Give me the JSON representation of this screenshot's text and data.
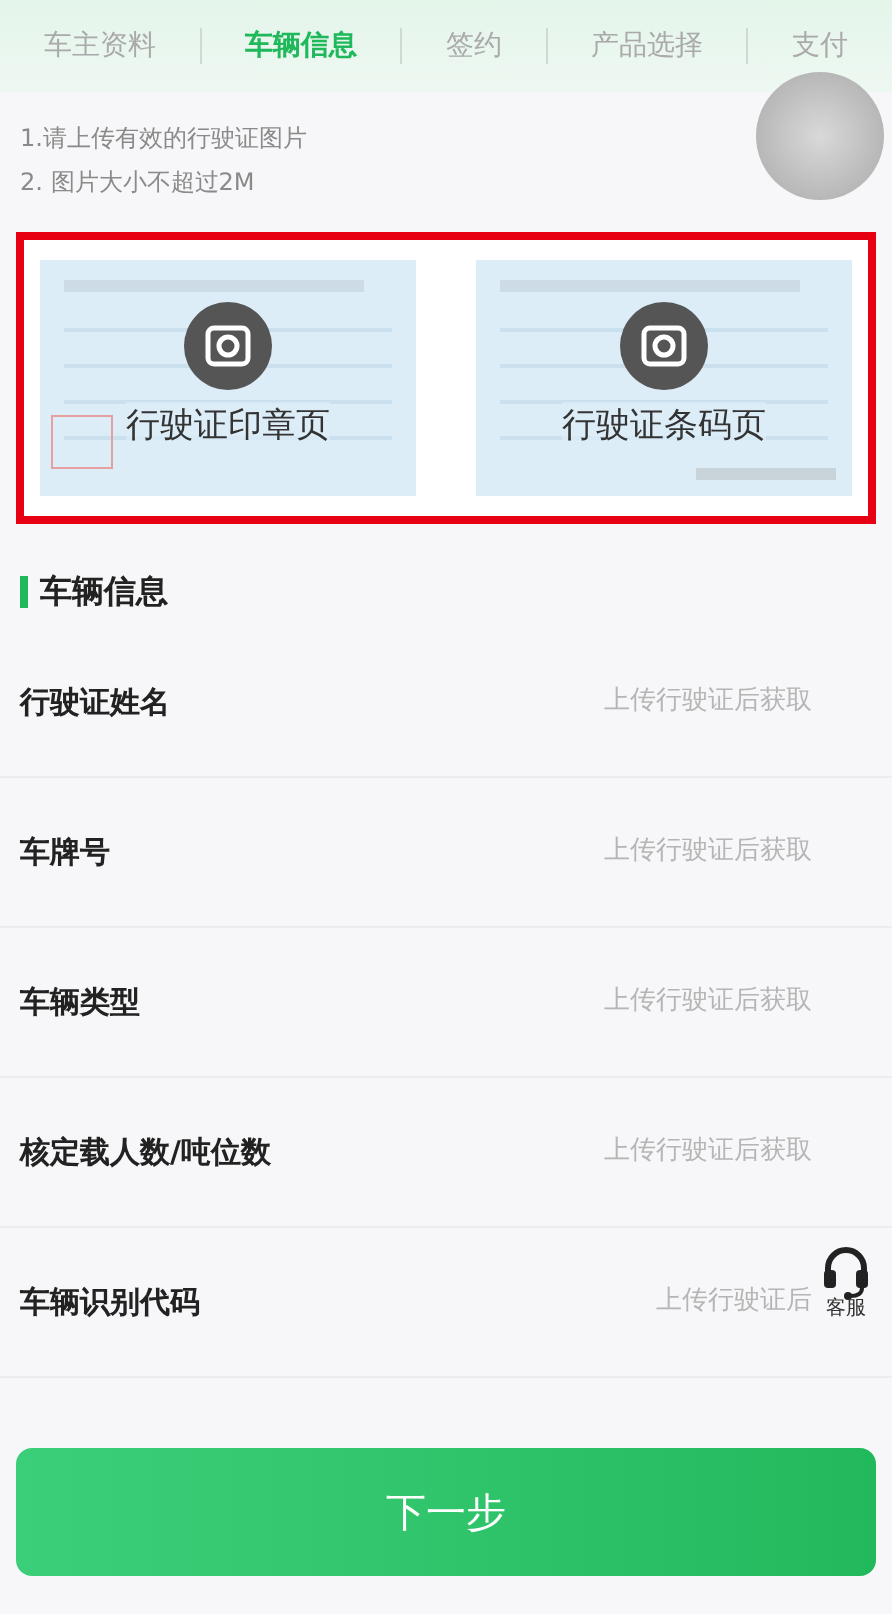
{
  "tabs": [
    {
      "label": "车主资料",
      "selected": false
    },
    {
      "label": "车辆信息",
      "selected": true
    },
    {
      "label": "签约",
      "selected": false
    },
    {
      "label": "产品选择",
      "selected": false
    },
    {
      "label": "支付",
      "selected": false
    }
  ],
  "notes": [
    "1.请上传有效的行驶证图片",
    "2. 图片大小不超过2M"
  ],
  "uploads": [
    {
      "label": "行驶证印章页"
    },
    {
      "label": "行驶证条码页"
    }
  ],
  "section_title": "车辆信息",
  "fields": [
    {
      "label": "行驶证姓名",
      "placeholder": "上传行驶证后获取"
    },
    {
      "label": "车牌号",
      "placeholder": "上传行驶证后获取"
    },
    {
      "label": "车辆类型",
      "placeholder": "上传行驶证后获取"
    },
    {
      "label": "核定载人数/吨位数",
      "placeholder": "上传行驶证后获取"
    },
    {
      "label": "车辆识别代码",
      "placeholder": "上传行驶证后"
    }
  ],
  "service": {
    "label": "客服"
  },
  "next_button": "下一步"
}
